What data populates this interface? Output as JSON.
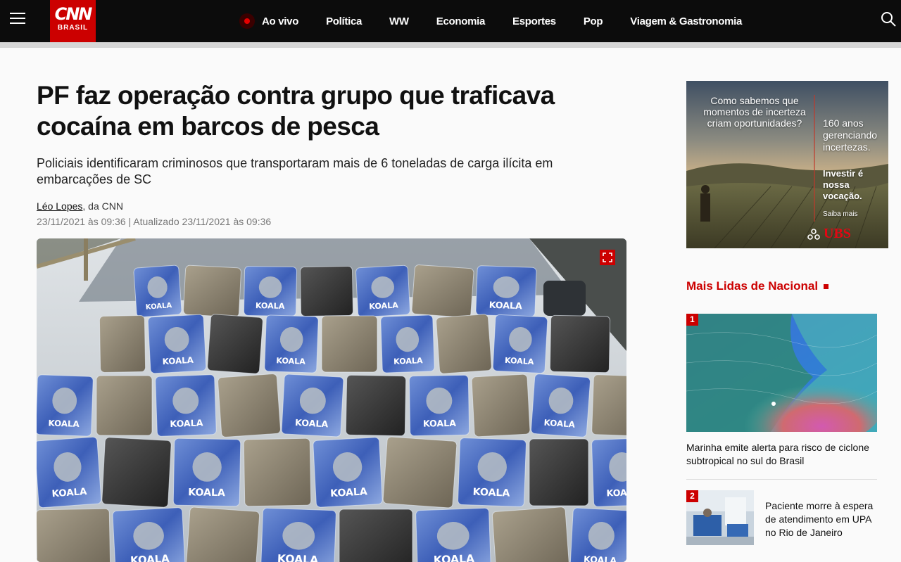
{
  "header": {
    "logo_main": "CNN",
    "logo_sub": "BRASIL",
    "nav": [
      "Ao vivo",
      "Política",
      "WW",
      "Economia",
      "Esportes",
      "Pop",
      "Viagem & Gastronomia"
    ]
  },
  "article": {
    "headline": "PF faz operação contra grupo que traficava cocaína em barcos de pesca",
    "subhead": "Policiais identificaram criminosos que transportaram mais de 6 toneladas de carga ilícita em embarcações de SC",
    "author": "Léo Lopes",
    "source": ", da CNN",
    "dateline": "23/11/2021 às 09:36 | Atualizado 23/11/2021 às 09:36",
    "photo_label": "KOALA"
  },
  "ad": {
    "question": "Como sabemos que momentos de incerteza criam oportunidades?",
    "years": "160 anos gerenciando incertezas.",
    "slogan": "Investir é nossa vocação.",
    "more": "Saiba mais",
    "brand": "UBS"
  },
  "most_read": {
    "title": "Mais Lidas de Nacional",
    "items": [
      {
        "rank": "1",
        "title": "Marinha emite alerta para risco de ciclone subtropical no sul do Brasil"
      },
      {
        "rank": "2",
        "title": "Paciente morre à espera de atendimento em UPA no Rio de Janeiro"
      }
    ]
  },
  "colors": {
    "brand_red": "#cc0000",
    "topbar": "#0c0c0c"
  }
}
